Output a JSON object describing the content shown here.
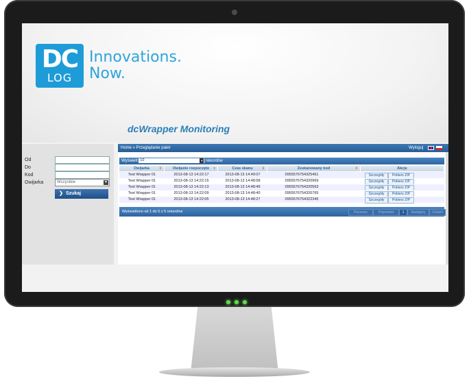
{
  "brand": {
    "logo_top": "DC",
    "logo_bottom": "LOG",
    "tagline_line1": "Innovations.",
    "tagline_line2": "Now."
  },
  "app_title": "dcWrapper Monitoring",
  "breadcrumb": "Home » Przeglądanie palet",
  "logout_label": "Wyloguj",
  "filters": {
    "od_label": "Od",
    "do_label": "Do",
    "kod_label": "Kod",
    "owijarka_label": "Owijarka",
    "owijarka_value": "Wszystkie",
    "search_button": "Szukaj"
  },
  "table": {
    "show_label": "Wyświetl",
    "page_size": "10",
    "records_label": "rekordów",
    "columns": [
      "Owijarka",
      "Owijanie rozpoczęto",
      "Czas skanu",
      "Zeskanowany kod",
      "Akcje"
    ],
    "rows": [
      {
        "owijarka": "Test Wrapper 01",
        "start": "2013-08-13 14:22:17",
        "scan": "2013-08-13 14:49:07",
        "code": "0955576754325461",
        "details": "Szczegóły",
        "zip": "Pobierz ZIP"
      },
      {
        "owijarka": "Test Wrapper 01",
        "start": "2013-08-13 14:22:15",
        "scan": "2013-08-13 14:48:58",
        "code": "0955576754320969",
        "details": "Szczegóły",
        "zip": "Pobierz ZIP"
      },
      {
        "owijarka": "Test Wrapper 01",
        "start": "2013-08-13 14:22:13",
        "scan": "2013-08-13 14:48:49",
        "code": "0955576754320563",
        "details": "Szczegóły",
        "zip": "Pobierz ZIP"
      },
      {
        "owijarka": "Test Wrapper 01",
        "start": "2013-08-13 14:22:09",
        "scan": "2013-08-13 14:48:40",
        "code": "0955576754326765",
        "details": "Szczegóły",
        "zip": "Pobierz ZIP"
      },
      {
        "owijarka": "Test Wrapper 01",
        "start": "2013-08-13 14:22:05",
        "scan": "2013-08-13 14:48:27",
        "code": "0955576754322345",
        "details": "Szczegóły",
        "zip": "Pobierz ZIP"
      }
    ],
    "footer_text": "Wyświetlono od 1 do 5 z 5 rekordów",
    "pager": {
      "first": "Pierwszy",
      "prev": "Poprzedni",
      "current": "1",
      "next": "Następny",
      "last": "Ostatni"
    }
  },
  "colors": {
    "accent": "#1e9cd8",
    "bar": "#2f659f",
    "odd_row": "#eef0ff"
  },
  "icons": {
    "uk_flag": "uk-flag-icon",
    "pl_flag": "pl-flag-icon",
    "search_chevron": "chevron-right-icon",
    "sort": "sort-icon"
  }
}
